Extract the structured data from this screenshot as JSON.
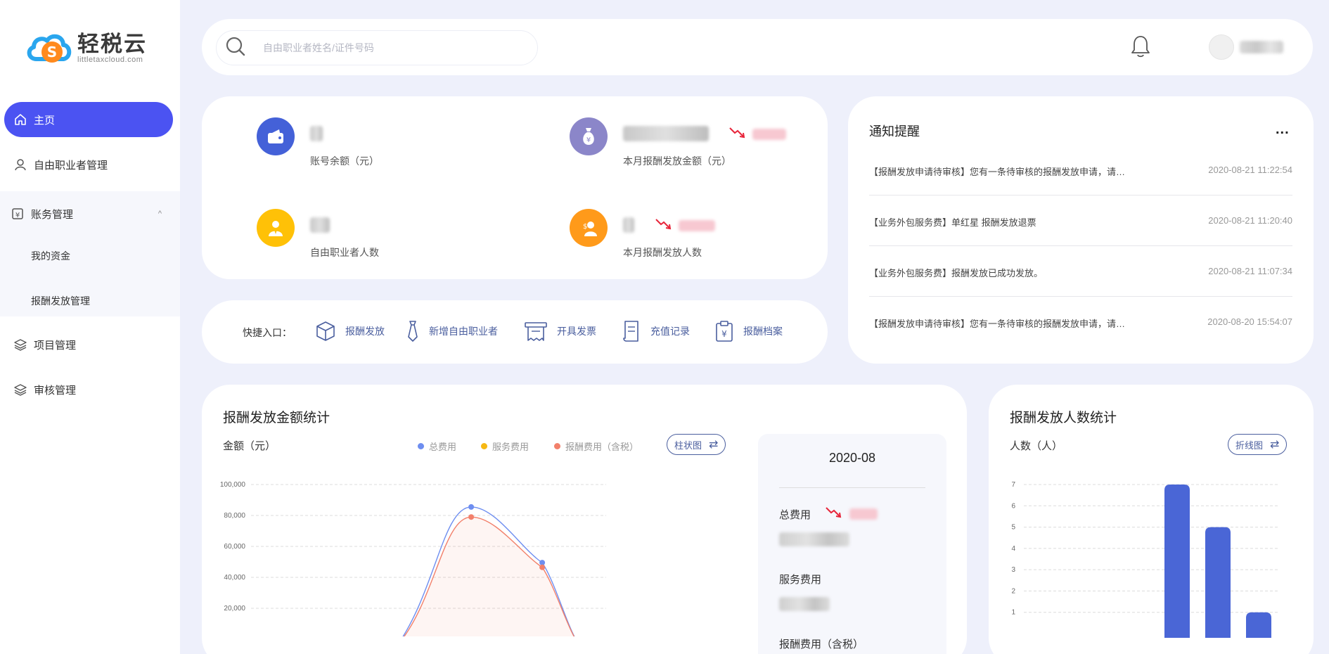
{
  "brand": {
    "name": "轻税云",
    "domain": "littletaxcloud.com"
  },
  "sidebar": {
    "items": [
      {
        "label": "主页",
        "icon": "home-icon",
        "active": true
      },
      {
        "label": "自由职业者管理",
        "icon": "user-icon"
      },
      {
        "label": "账务管理",
        "icon": "ledger-icon",
        "expanded": true
      },
      {
        "label": "项目管理",
        "icon": "layers-icon"
      },
      {
        "label": "审核管理",
        "icon": "layers-icon"
      }
    ],
    "sub_items": [
      {
        "label": "我的资金"
      },
      {
        "label": "报酬发放管理"
      }
    ],
    "collapse_glyph": "^"
  },
  "search": {
    "placeholder": "自由职业者姓名/证件号码",
    "value": ""
  },
  "stats": [
    {
      "label": "账号余额（元）",
      "icon": "wallet-icon",
      "color": "#4461d8"
    },
    {
      "label": "本月报酬发放金额（元）",
      "icon": "money-bag-icon",
      "color": "#8b86c9"
    },
    {
      "label": "自由职业者人数",
      "icon": "freelancer-icon",
      "color": "#ffc107"
    },
    {
      "label": "本月报酬发放人数",
      "icon": "payee-icon",
      "color": "#ff9a1a"
    }
  ],
  "quick": {
    "label": "快捷入口：",
    "items": [
      {
        "label": "报酬发放",
        "icon": "box-icon"
      },
      {
        "label": "新增自由职业者",
        "icon": "tie-icon"
      },
      {
        "label": "开具发票",
        "icon": "invoice-icon"
      },
      {
        "label": "充值记录",
        "icon": "scroll-icon"
      },
      {
        "label": "报酬档案",
        "icon": "clipboard-yen-icon"
      }
    ]
  },
  "notice": {
    "title": "通知提醒",
    "more": "...",
    "items": [
      {
        "text": "【报酬发放申请待审核】您有一条待审核的报酬发放申请，请…",
        "time": "2020-08-21 11:22:54"
      },
      {
        "text": "【业务外包服务费】单红星 报酬发放退票",
        "time": "2020-08-21 11:20:40"
      },
      {
        "text": "【业务外包服务费】报酬发放已成功发放。",
        "time": "2020-08-21 11:07:34"
      },
      {
        "text": "【报酬发放申请待审核】您有一条待审核的报酬发放申请，请…",
        "time": "2020-08-20 15:54:07"
      }
    ]
  },
  "amount_card": {
    "title": "报酬发放金额统计",
    "unit": "金额（元）",
    "switch_label": "柱状图",
    "legend": [
      {
        "name": "总费用",
        "color": "#6e8ef0"
      },
      {
        "name": "服务费用",
        "color": "#f6b813"
      },
      {
        "name": "报酬费用（含税）",
        "color": "#f2806b"
      }
    ],
    "panel": {
      "month": "2020-08",
      "labels": [
        "总费用",
        "服务费用",
        "报酬费用（含税）"
      ]
    }
  },
  "people_card": {
    "title": "报酬发放人数统计",
    "unit": "人数（人）",
    "switch_label": "折线图"
  },
  "chart_data": [
    {
      "type": "area",
      "title": "报酬发放金额统计",
      "ylabel": "金额（元）",
      "ylim": [
        0,
        100000
      ],
      "yticks": [
        "20,000",
        "40,000",
        "60,000",
        "80,000",
        "100,000"
      ],
      "grid": true,
      "series": [
        {
          "name": "总费用",
          "color": "#6e8ef0",
          "points": [
            [
              0.62,
              85500
            ],
            [
              0.82,
              49500
            ]
          ]
        },
        {
          "name": "报酬费用（含税）",
          "color": "#f2806b",
          "points": [
            [
              0.62,
              79000
            ],
            [
              0.82,
              46500
            ]
          ]
        }
      ]
    },
    {
      "type": "bar",
      "title": "报酬发放人数统计",
      "ylabel": "人数（人）",
      "ylim": [
        0,
        7
      ],
      "yticks": [
        "1",
        "2",
        "3",
        "4",
        "5",
        "6",
        "7"
      ],
      "grid": true,
      "values": [
        7,
        5,
        1
      ],
      "color": "#4a66d6"
    }
  ]
}
